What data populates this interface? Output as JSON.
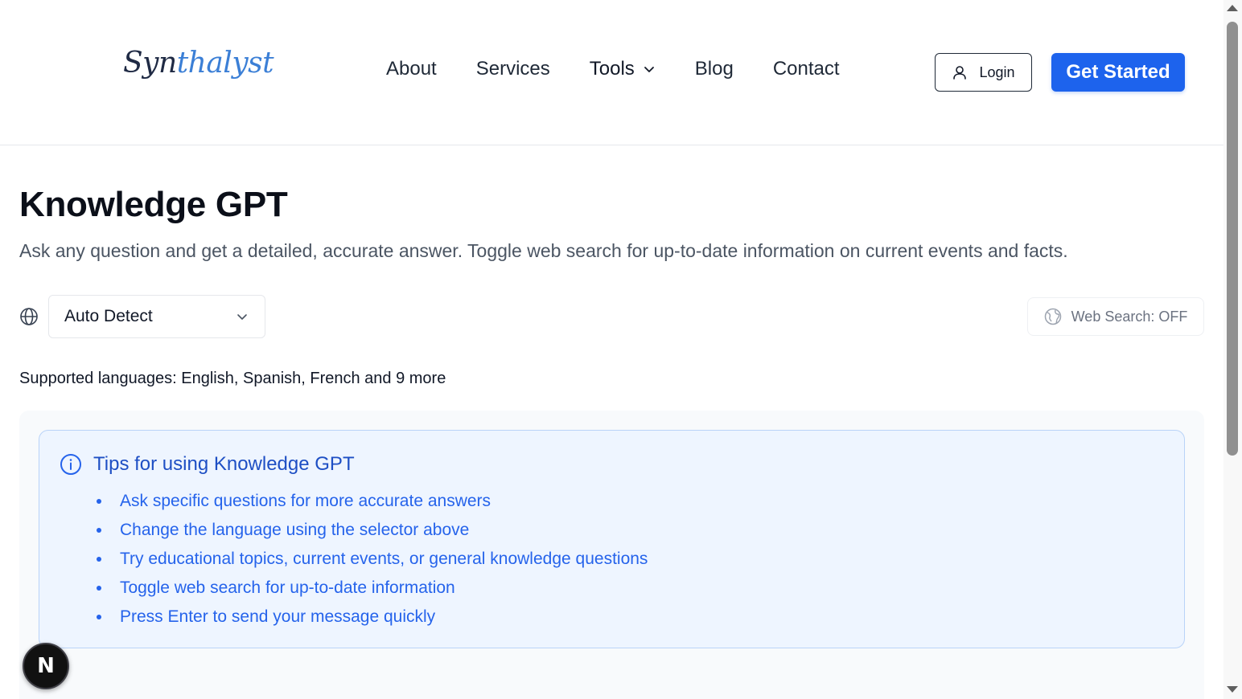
{
  "brand": {
    "logo_text_a": "Syn",
    "logo_text_b": "thalyst"
  },
  "nav": {
    "items": [
      {
        "label": "About"
      },
      {
        "label": "Services"
      },
      {
        "label": "Tools"
      },
      {
        "label": "Blog"
      },
      {
        "label": "Contact"
      }
    ],
    "login_label": "Login",
    "cta_label": "Get Started"
  },
  "main": {
    "title": "Knowledge GPT",
    "description": "Ask any question and get a detailed, accurate answer. Toggle web search for up-to-date information on current events and facts.",
    "language_select": {
      "value": "Auto Detect"
    },
    "web_search_label": "Web Search: OFF",
    "supported_languages": "Supported languages: English, Spanish, French and 9 more"
  },
  "tips": {
    "title": "Tips for using Knowledge GPT",
    "items": [
      "Ask specific questions for more accurate answers",
      "Change the language using the selector above",
      "Try educational topics, current events, or general knowledge questions",
      "Toggle web search for up-to-date information",
      "Press Enter to send your message quickly"
    ]
  },
  "dev_badge": {
    "letter": "N"
  },
  "colors": {
    "accent": "#1d63ed",
    "tips_text": "#2563eb",
    "tips_bg": "#eef5ff"
  }
}
